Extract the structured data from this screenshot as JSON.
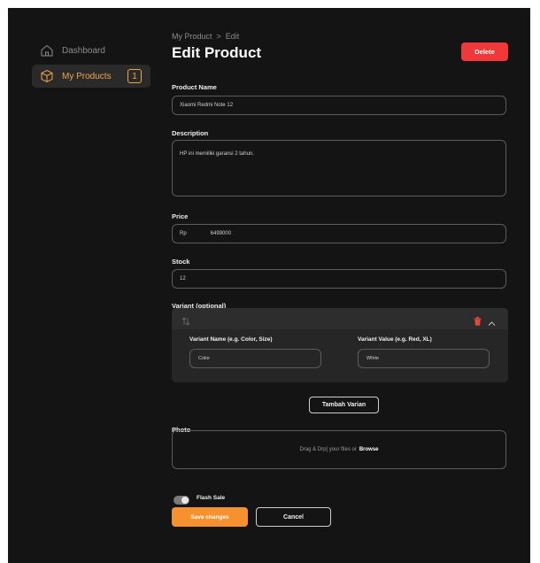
{
  "sidebar": {
    "items": [
      {
        "label": "Dashboard"
      },
      {
        "label": "My Products",
        "badge": "1"
      }
    ]
  },
  "breadcrumb": {
    "parent": "My Product",
    "separator": ">",
    "current": "Edit"
  },
  "header": {
    "title": "Edit Product",
    "delete_label": "Delete"
  },
  "form": {
    "name": {
      "label": "Product Name",
      "value": "Xiaomi Redmi Note 12"
    },
    "description": {
      "label": "Description",
      "value": "HP ini memiliki garansi 2 tahun."
    },
    "price": {
      "label": "Price",
      "prefix": "Rp",
      "value": "6499000"
    },
    "stock": {
      "label": "Stock",
      "value": "12"
    },
    "variant": {
      "label": "Variant (optional)",
      "name_label": "Variant Name (e.g. Color, Size)",
      "name_value": "Color",
      "value_label": "Variant Value (e.g. Red, XL)",
      "value_value": "White",
      "add_label": "Tambah Varian"
    },
    "photo": {
      "label": "Photo",
      "drop_text": "Drag & Drp[ your files or",
      "browse": "Browse"
    },
    "flash_sale": {
      "label": "Flash Sale",
      "enabled": true
    }
  },
  "actions": {
    "save_label": "Save changes",
    "cancel_label": "Cancel"
  },
  "colors": {
    "accent": "#f5922f",
    "danger": "#f0383a",
    "background": "#141414",
    "active_text": "#f2a44a"
  },
  "icons": [
    "home-icon",
    "box-icon",
    "drag-handle-icon",
    "trash-icon",
    "chevron-up-icon"
  ]
}
